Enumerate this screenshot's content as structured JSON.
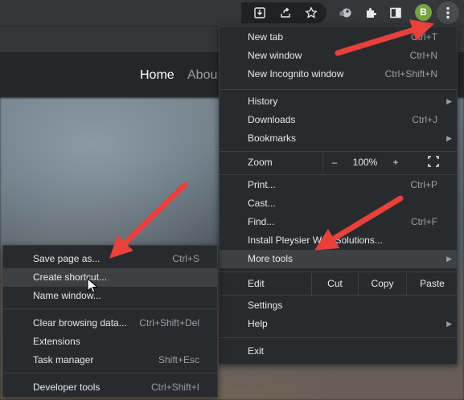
{
  "page": {
    "nav": [
      "Home",
      "Abou"
    ]
  },
  "toolbar": {
    "avatar_letter": "B",
    "icons": [
      "install-icon",
      "share-icon",
      "bookmark-star-icon",
      "extension-pin-icon",
      "puzzle-icon",
      "side-panel-icon",
      "kebab-menu-icon"
    ]
  },
  "menu": {
    "new_tab": {
      "label": "New tab",
      "shortcut": "Ctrl+T"
    },
    "new_window": {
      "label": "New window",
      "shortcut": "Ctrl+N"
    },
    "new_incognito": {
      "label": "New Incognito window",
      "shortcut": "Ctrl+Shift+N"
    },
    "history": {
      "label": "History"
    },
    "downloads": {
      "label": "Downloads",
      "shortcut": "Ctrl+J"
    },
    "bookmarks": {
      "label": "Bookmarks"
    },
    "zoom": {
      "label": "Zoom",
      "minus": "–",
      "value": "100%",
      "plus": "+"
    },
    "print": {
      "label": "Print...",
      "shortcut": "Ctrl+P"
    },
    "cast": {
      "label": "Cast..."
    },
    "find": {
      "label": "Find...",
      "shortcut": "Ctrl+F"
    },
    "install": {
      "label": "Install Pleysier Web Solutions..."
    },
    "more_tools": {
      "label": "More tools"
    },
    "edit": {
      "label": "Edit",
      "cut": "Cut",
      "copy": "Copy",
      "paste": "Paste"
    },
    "settings": {
      "label": "Settings"
    },
    "help": {
      "label": "Help"
    },
    "exit": {
      "label": "Exit"
    }
  },
  "submenu": {
    "save_page": {
      "label": "Save page as...",
      "shortcut": "Ctrl+S"
    },
    "create_shortcut": {
      "label": "Create shortcut..."
    },
    "name_window": {
      "label": "Name window..."
    },
    "clear_data": {
      "label": "Clear browsing data...",
      "shortcut": "Ctrl+Shift+Del"
    },
    "extensions": {
      "label": "Extensions"
    },
    "task_manager": {
      "label": "Task manager",
      "shortcut": "Shift+Esc"
    },
    "dev_tools": {
      "label": "Developer tools",
      "shortcut": "Ctrl+Shift+I"
    }
  },
  "colors": {
    "annotation_arrow": "#e8413c",
    "menu_bg": "#292a2d",
    "highlight": "#3f4042",
    "avatar": "#74a340"
  }
}
